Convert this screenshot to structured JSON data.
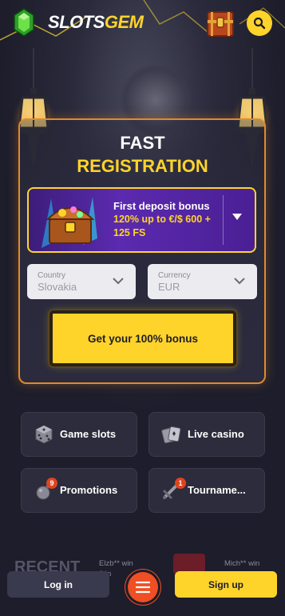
{
  "header": {
    "brand_part1": "SLOTS",
    "brand_part2": "GEM",
    "icons": [
      "gem-logo-icon",
      "treasure-chest-icon",
      "search-icon"
    ]
  },
  "registration": {
    "title_line1": "FAST",
    "title_line2": "REGISTRATION",
    "bonus": {
      "title": "First deposit bonus",
      "subtitle": "120% up to €/$ 600 + 125 FS"
    },
    "country": {
      "label": "Country",
      "value": "Slovakia"
    },
    "currency": {
      "label": "Currency",
      "value": "EUR"
    },
    "cta_label": "Get your 100% bonus"
  },
  "categories": [
    {
      "label": "Game slots",
      "icon": "dice-icon"
    },
    {
      "label": "Live casino",
      "icon": "cards-icon"
    },
    {
      "label": "Promotions",
      "icon": "bomb-icon",
      "badge": "9"
    },
    {
      "label": "Tourname...",
      "icon": "sword-icon",
      "badge": "1"
    }
  ],
  "recent": {
    "title": "RECENT",
    "items": [
      "Elzb** win",
      "6 in",
      "Mich** win"
    ]
  },
  "bottom_bar": {
    "login_label": "Log in",
    "signup_label": "Sign up"
  },
  "colors": {
    "accent_yellow": "#ffd42a",
    "accent_orange": "#e08a2c",
    "menu_red": "#f04e23",
    "bonus_purple": "#5b2ab0",
    "background": "#1d1d2b"
  }
}
